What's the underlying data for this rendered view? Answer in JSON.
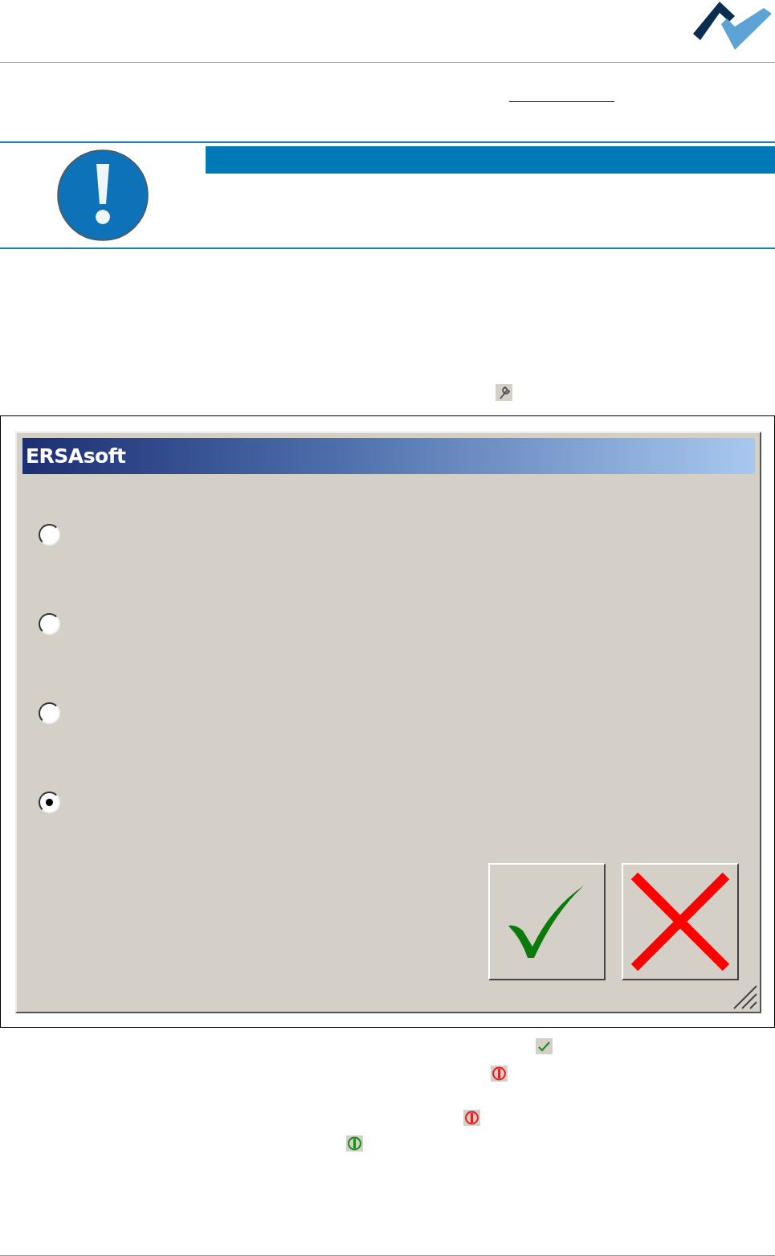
{
  "dialog": {
    "title": "ERSAsoft",
    "options": [
      {
        "selected": false
      },
      {
        "selected": false
      },
      {
        "selected": false
      },
      {
        "selected": true
      }
    ],
    "buttons": [
      {
        "kind": "confirm"
      },
      {
        "kind": "cancel"
      }
    ]
  },
  "status_icons": [
    {
      "kind": "check"
    },
    {
      "kind": "power",
      "color": "#e02020"
    },
    {
      "kind": "power",
      "color": "#e02020"
    },
    {
      "kind": "power",
      "color": "#1a8a1a"
    }
  ]
}
